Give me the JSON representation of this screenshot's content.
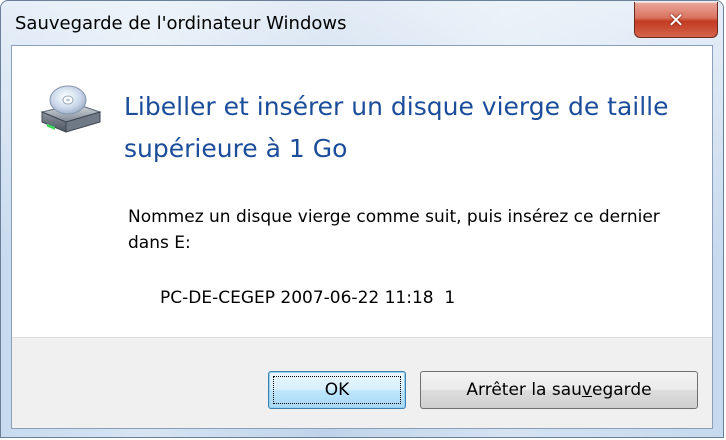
{
  "window": {
    "title": "Sauvegarde de l'ordinateur Windows"
  },
  "dialog": {
    "icon": "optical-drive-icon",
    "main_instruction": "Libeller et insérer un disque vierge de taille supérieure à 1 Go",
    "body": "Nommez un disque vierge comme suit, puis insérez ce dernier dans E:",
    "disc_label": "PC-DE-CEGEP 2007-06-22 11:18  1"
  },
  "buttons": {
    "ok_label": "OK",
    "stop_prefix": "Arrêter la sau",
    "stop_access_key": "v",
    "stop_suffix": "egarde"
  },
  "colors": {
    "instruction": "#1b4d9a",
    "close_button": "#c23b22",
    "footer": "#f0f0f0"
  }
}
